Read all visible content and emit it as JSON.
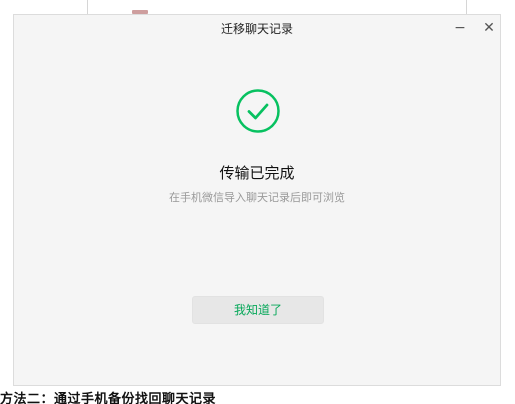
{
  "background": {
    "caption": "方法二：通过手机备份找回聊天记录"
  },
  "dialog": {
    "title": "迁移聊天记录",
    "minimize_glyph": "−",
    "close_glyph": "✕",
    "status_icon": "check-circle-icon",
    "status_title": "传输已完成",
    "status_subtitle": "在手机微信导入聊天记录后即可浏览",
    "ok_button_label": "我知道了"
  },
  "colors": {
    "accent": "#07c160",
    "button_text": "#07a85a",
    "dialog_bg": "#f5f5f5",
    "button_bg": "#e7e7e7"
  }
}
